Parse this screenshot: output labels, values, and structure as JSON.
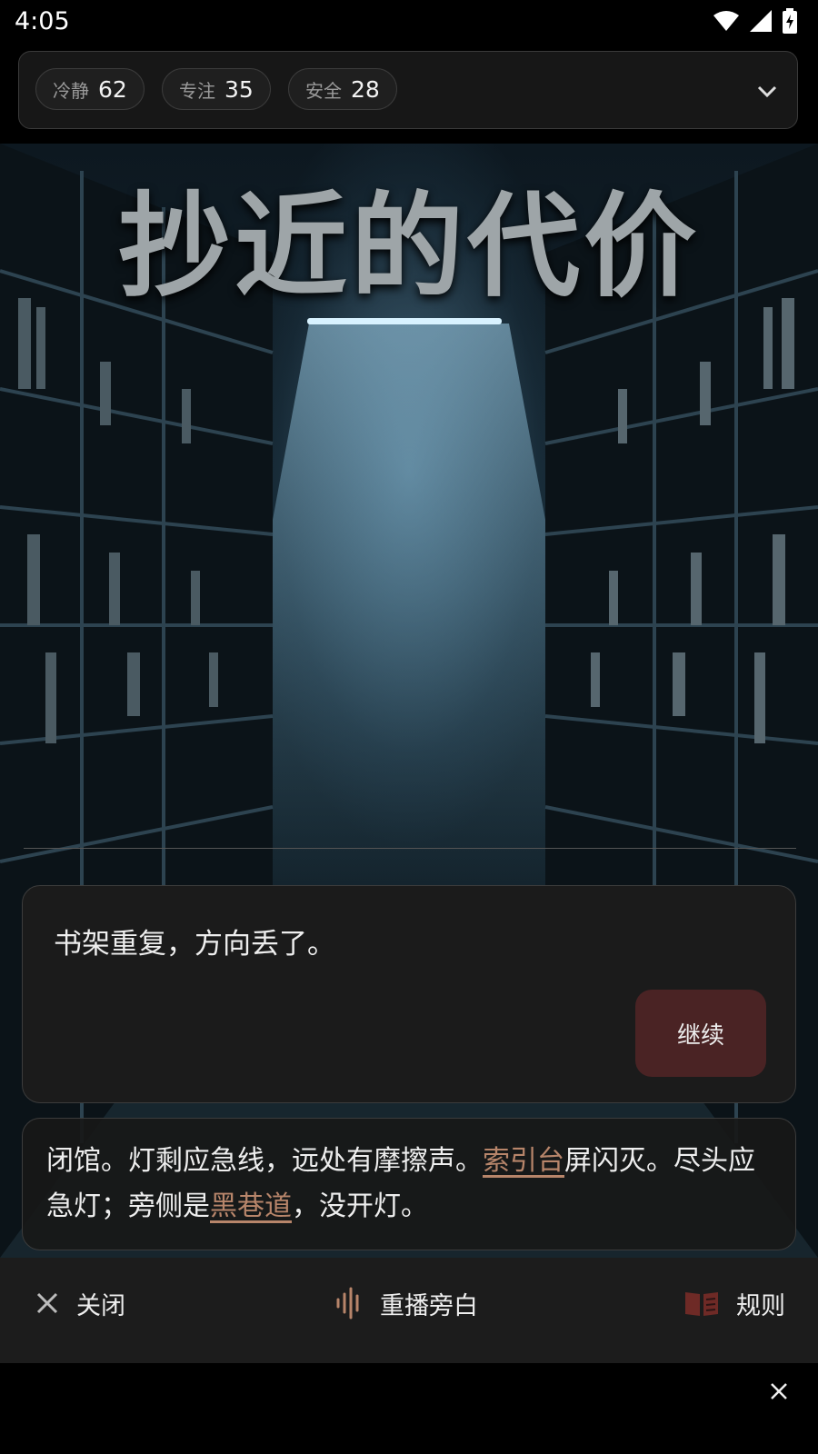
{
  "status_bar": {
    "time": "4:05"
  },
  "stats": [
    {
      "label": "冷静",
      "value": "62"
    },
    {
      "label": "专注",
      "value": "35"
    },
    {
      "label": "安全",
      "value": "28"
    }
  ],
  "scene": {
    "title": "抄近的代价"
  },
  "dialog": {
    "text": "书架重复，方向丢了。",
    "continue_label": "继续"
  },
  "narration": {
    "part1": "闭馆。灯剩应急线，远处有摩擦声。",
    "link1": "索引台",
    "part2": "屏闪灭。尽头应急灯；旁侧是",
    "link2": "黑巷道",
    "part3": "，没开灯。"
  },
  "bottom_bar": {
    "close_label": "关闭",
    "replay_label": "重播旁白",
    "rules_label": "规则"
  },
  "colors": {
    "accent": "#b7856a",
    "button": "#4a2324"
  },
  "icons": [
    "wifi-icon",
    "signal-icon",
    "battery-charging-icon",
    "chevron-down-icon",
    "close-icon",
    "audio-wave-icon",
    "book-icon"
  ]
}
